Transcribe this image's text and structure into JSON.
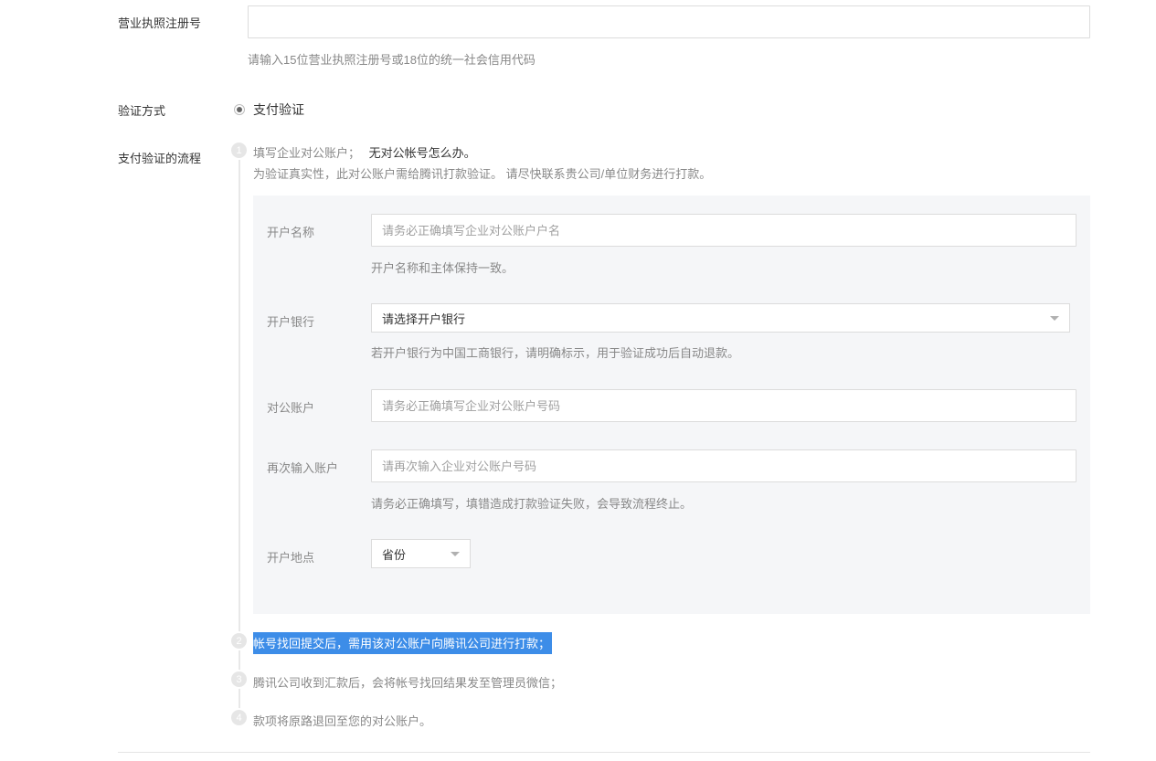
{
  "license": {
    "label": "营业执照注册号",
    "value": "",
    "placeholder": "",
    "hint": "请输入15位营业执照注册号或18位的统一社会信用代码"
  },
  "verify_method": {
    "label": "验证方式",
    "option": "支付验证",
    "selected": true
  },
  "flow": {
    "label": "支付验证的流程",
    "steps": [
      {
        "num": "1",
        "text": "填写企业对公账户；",
        "link": "无对公帐号怎么办。",
        "subtext": "为验证真实性，此对公账户需给腾讯打款验证。 请尽快联系贵公司/单位财务进行打款。"
      },
      {
        "num": "2",
        "text": "帐号找回提交后，需用该对公账户向腾讯公司进行打款；"
      },
      {
        "num": "3",
        "text": "腾讯公司收到汇款后，会将帐号找回结果发至管理员微信；"
      },
      {
        "num": "4",
        "text": "款项将原路退回至您的对公账户。"
      }
    ]
  },
  "account_form": {
    "name": {
      "label": "开户名称",
      "placeholder": "请务必正确填写企业对公账户户名",
      "hint": "开户名称和主体保持一致。"
    },
    "bank": {
      "label": "开户银行",
      "value": "请选择开户银行",
      "hint": "若开户银行为中国工商银行，请明确标示，用于验证成功后自动退款。"
    },
    "account": {
      "label": "对公账户",
      "placeholder": "请务必正确填写企业对公账户号码"
    },
    "account_confirm": {
      "label": "再次输入账户",
      "placeholder": "请再次输入企业对公账户号码",
      "hint": "请务必正确填写，填错造成打款验证失败，会导致流程终止。"
    },
    "location": {
      "label": "开户地点",
      "value": "省份"
    }
  },
  "colors": {
    "highlight": "#3d8de8",
    "panel_bg": "#f5f6f8",
    "border": "#dcdcdc"
  }
}
